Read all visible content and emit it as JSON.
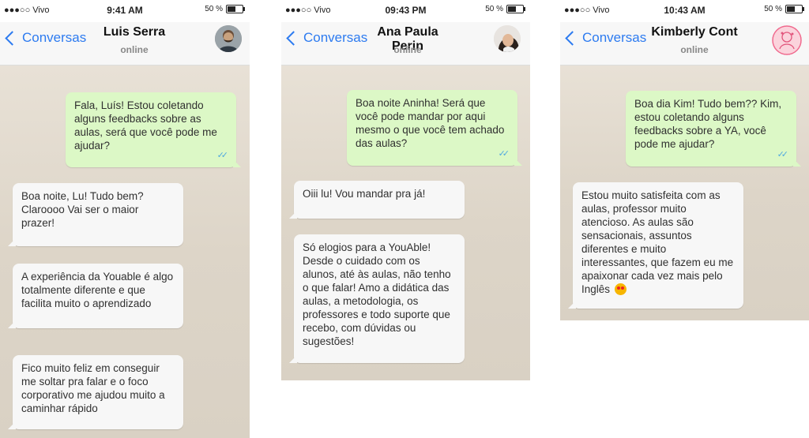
{
  "phones": [
    {
      "status": {
        "carrier": "●●●○○ Vivo",
        "time": "9:41 AM",
        "battery": "50 %",
        "battery_level": 0.5
      },
      "back_label": "Conversas",
      "contact_name": "Luis Serra",
      "contact_status": "online",
      "avatar_icon": "person-avatar-icon",
      "messages": [
        {
          "dir": "out",
          "text": "Fala, Luís! Estou coletando alguns feedbacks sobre as aulas, será que você pode me ajudar?"
        },
        {
          "dir": "in",
          "text": "Boa noite, Lu! Tudo bem? Claroooo Vai ser o maior prazer!"
        },
        {
          "dir": "in",
          "text": "A experiência da Youable é algo totalmente diferente e que facilita muito o aprendizado"
        },
        {
          "dir": "in",
          "text": "Fico muito feliz em conseguir me soltar pra falar e o foco corporativo me ajudou muito a caminhar rápido"
        }
      ]
    },
    {
      "status": {
        "carrier": "●●●○○ Vivo",
        "time": "09:43 PM",
        "battery": "50 %",
        "battery_level": 0.5
      },
      "back_label": "Conversas",
      "contact_name": "Ana Paula Perin",
      "contact_status": "online",
      "avatar_icon": "person-avatar-icon",
      "messages": [
        {
          "dir": "out",
          "text": "Boa noite Aninha! Será que você pode mandar por aqui mesmo o que você tem achado das aulas?"
        },
        {
          "dir": "in",
          "text": "Oiii lu! Vou mandar pra já!"
        },
        {
          "dir": "in",
          "text": "Só elogios para a YouAble! Desde o cuidado com os alunos, até às aulas, não tenho o que falar! Amo a didática das aulas, a metodologia, os professores e todo suporte que recebo, com dúvidas ou sugestões!"
        }
      ]
    },
    {
      "status": {
        "carrier": "●●●○○ Vivo",
        "time": "10:43 AM",
        "battery": "50 %",
        "battery_level": 0.5
      },
      "back_label": "Conversas",
      "contact_name": "Kimberly Cont",
      "contact_status": "online",
      "avatar_icon": "pink-illustration-avatar-icon",
      "messages": [
        {
          "dir": "out",
          "text": "Boa dia Kim! Tudo bem?? Kim, estou coletando alguns feedbacks sobre a YA, você pode me ajudar?"
        },
        {
          "dir": "in",
          "text": "Estou muito satisfeita com as aulas, professor muito atencioso. As aulas são sensacionais, assuntos diferentes e muito interessantes, que fazem eu me apaixonar cada vez mais pelo Inglês",
          "emoji": "star-struck-emoji-icon"
        }
      ]
    }
  ],
  "colors": {
    "accent": "#2d7bf0",
    "outgoing_bubble": "#dcf8c6",
    "incoming_bubble": "#f7f7f7",
    "chat_bg": "#e3dccf",
    "ticks": "#4fa8e0"
  }
}
